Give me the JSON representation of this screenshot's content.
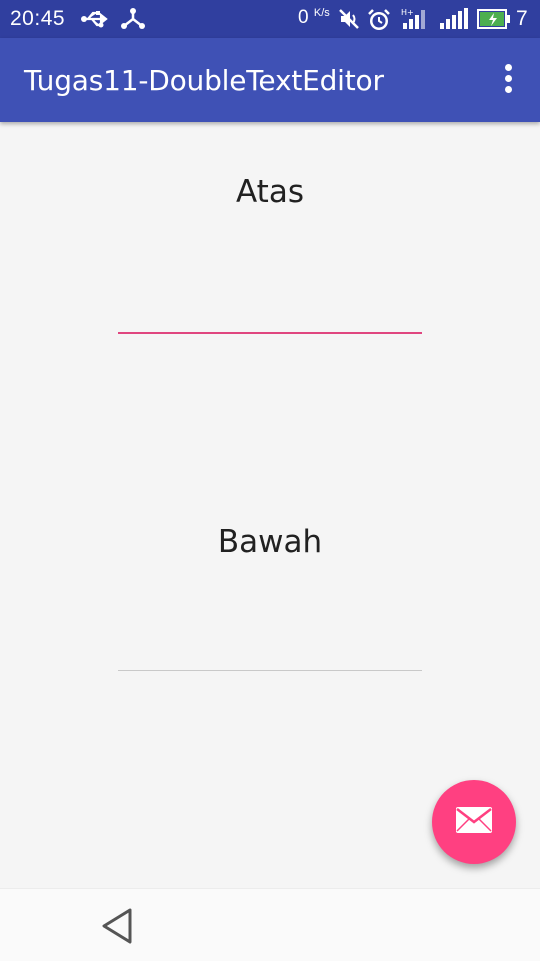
{
  "status_bar": {
    "time": "20:45",
    "net_speed_value": "0",
    "net_speed_unit": "K/s",
    "battery_level": "7",
    "icons": [
      "usb-icon",
      "share-icon",
      "mute-icon",
      "alarm-icon",
      "signal-h-icon",
      "signal-icon",
      "battery-icon"
    ]
  },
  "app_bar": {
    "title": "Tugas11-DoubleTextEditor",
    "overflow_icon": "more-vert-icon"
  },
  "content": {
    "top_label": "Atas",
    "top_input_value": "",
    "bottom_label": "Bawah",
    "bottom_input_value": ""
  },
  "fab": {
    "icon": "mail-icon",
    "color": "#ff4081"
  },
  "nav_bar": {
    "icons": [
      "back-icon"
    ]
  },
  "colors": {
    "status_bar": "#303f9f",
    "primary": "#3f51b5",
    "accent": "#ff4081"
  }
}
